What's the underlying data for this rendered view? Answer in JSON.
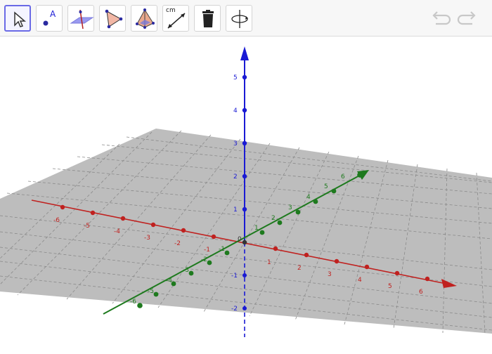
{
  "toolbar": {
    "tools": [
      {
        "name": "move-tool"
      },
      {
        "name": "point-tool",
        "label": "A"
      },
      {
        "name": "plane-tool"
      },
      {
        "name": "polygon-tool"
      },
      {
        "name": "pyramid-tool"
      },
      {
        "name": "distance-tool",
        "label": "cm"
      },
      {
        "name": "delete-tool"
      },
      {
        "name": "rotate-view-tool"
      }
    ],
    "selected": "move-tool"
  },
  "axes": {
    "x": {
      "color": "#c0211f",
      "ticks": [
        "-6",
        "-5",
        "-4",
        "-3",
        "-2",
        "-1",
        "1",
        "2",
        "3",
        "4",
        "5",
        "6"
      ]
    },
    "y": {
      "color": "#1e7a1e",
      "ticks": [
        "-1",
        "1",
        "2",
        "3",
        "4",
        "5",
        "6",
        "-4",
        "-3",
        "-2",
        "-5",
        "-6"
      ]
    },
    "z": {
      "color": "#1a1ad4",
      "ticks": [
        "1",
        "2",
        "3",
        "4",
        "5",
        "-1",
        "-2"
      ]
    },
    "origin_label": "0"
  },
  "labels": {
    "x": {
      "m6": "-6",
      "m5": "-5",
      "m4": "-4",
      "m3": "-3",
      "m2": "-2",
      "m1": "-1",
      "p1": "1",
      "p2": "2",
      "p3": "3",
      "p4": "4",
      "p5": "5",
      "p6": "6"
    },
    "y": {
      "p1": "1",
      "p2": "2",
      "p3": "3",
      "p4": "4",
      "p5": "5",
      "p6": "6",
      "m1": "-1",
      "m2": "-2",
      "m3": "-3",
      "m4": "-4",
      "m5": "-5",
      "m6": "-6"
    },
    "z": {
      "p1": "1",
      "p2": "2",
      "p3": "3",
      "p4": "4",
      "p5": "5",
      "m1": "-1",
      "m2": "-2"
    },
    "origin": "0"
  },
  "plane_color": "#bdbdbd"
}
